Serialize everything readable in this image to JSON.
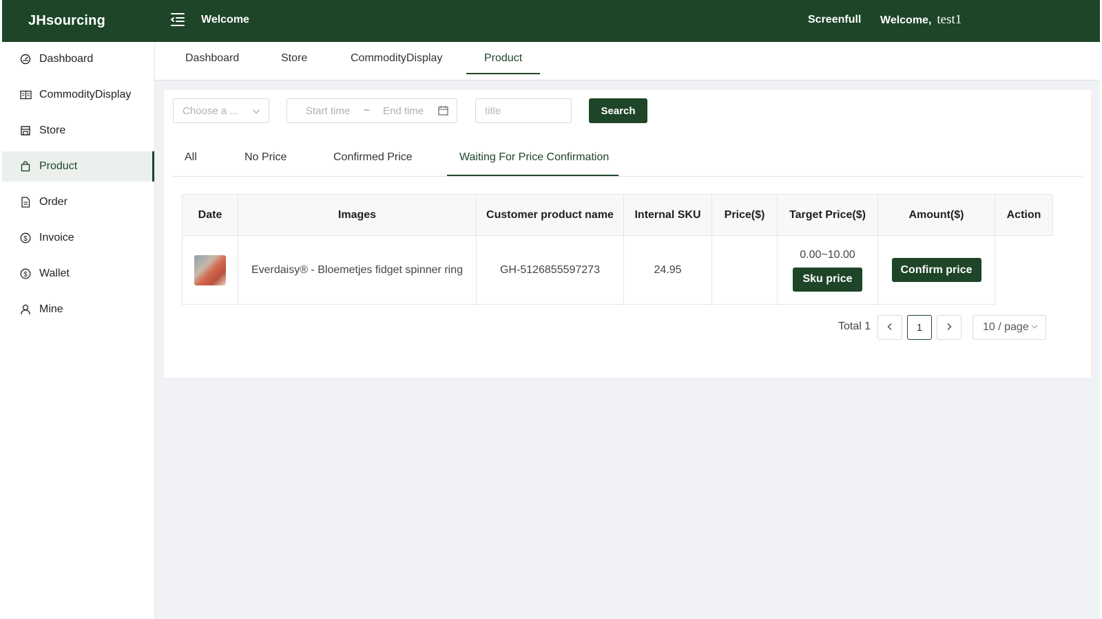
{
  "header": {
    "logo": "JHsourcing",
    "title": "Welcome",
    "screenfull": "Screenfull",
    "welcome": "Welcome,",
    "username": "test1"
  },
  "sidebar": {
    "items": [
      {
        "label": "Dashboard",
        "icon": "dashboard-icon"
      },
      {
        "label": "CommodityDisplay",
        "icon": "book-icon"
      },
      {
        "label": "Store",
        "icon": "store-icon"
      },
      {
        "label": "Product",
        "icon": "bag-icon",
        "active": true
      },
      {
        "label": "Order",
        "icon": "document-icon"
      },
      {
        "label": "Invoice",
        "icon": "dollar-circle-icon"
      },
      {
        "label": "Wallet",
        "icon": "dollar-circle-icon"
      },
      {
        "label": "Mine",
        "icon": "user-icon"
      }
    ]
  },
  "tags": {
    "items": [
      "Dashboard",
      "Store",
      "CommodityDisplay",
      "Product"
    ],
    "active": "Product"
  },
  "filters": {
    "select_placeholder": "Choose a ...",
    "start_placeholder": "Start time",
    "range_separator": "~",
    "end_placeholder": "End time",
    "title_placeholder": "title",
    "search_label": "Search"
  },
  "status_tabs": {
    "items": [
      "All",
      "No Price",
      "Confirmed Price",
      "Waiting For Price Confirmation"
    ],
    "active": "Waiting For Price Confirmation"
  },
  "table": {
    "headers": [
      "Date",
      "Images",
      "Customer product name",
      "Internal SKU",
      "Price($)",
      "Target Price($)",
      "Amount($)",
      "Action"
    ],
    "rows": [
      {
        "image": "product-thumbnail",
        "product_name": "Everdaisy® - Bloemetjes fidget spinner ring",
        "sku": "GH-5126855597273",
        "price": "24.95",
        "amount": "",
        "target_price_range": "0.00~10.00",
        "sku_price_label": "Sku price",
        "confirm_label": "Confirm price"
      }
    ]
  },
  "pagination": {
    "total": "Total 1",
    "current": "1",
    "page_size": "10 / page"
  },
  "colors": {
    "brand": "#1e4528",
    "background": "#f0f2f5"
  }
}
